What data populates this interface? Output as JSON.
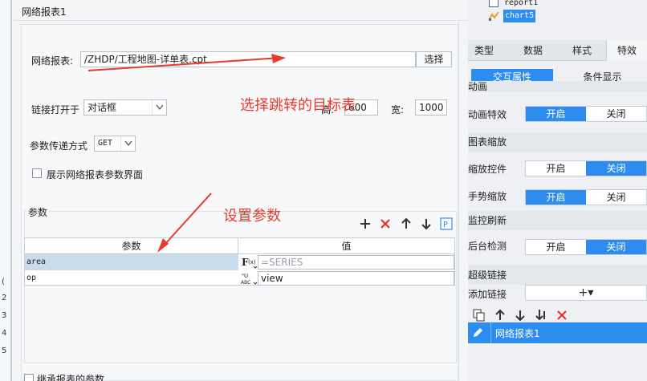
{
  "dialog": {
    "title": "网络报表1",
    "report_label": "网络报表:",
    "report_path": "/ZHDP/工程地图-详单表.cpt",
    "choose_button": "选择",
    "open_in_label": "链接打开于",
    "open_in_value": "对话框",
    "height_label": "高:",
    "height_value": "600",
    "width_label": "宽:",
    "width_value": "1000",
    "method_label": "参数传递方式",
    "method_value": "GET",
    "show_param_ui_label": "展示网络报表参数界面",
    "params_section_label": "参数",
    "params_table": {
      "headers": [
        "参数",
        "值"
      ],
      "rows": [
        {
          "name": "area",
          "type": "F(x)",
          "value": "=SERIES"
        },
        {
          "name": "op",
          "type": "ABC",
          "value": "view"
        }
      ]
    },
    "inherit_label": "继承报表的参数"
  },
  "annotations": {
    "target_note": "选择跳转的目标表",
    "params_note": "设置参数"
  },
  "right_panel": {
    "tree": [
      "report1",
      "chart5"
    ],
    "tabs": [
      "类型",
      "数据",
      "样式",
      "特效"
    ],
    "subtabs": [
      "交互属性",
      "条件显示"
    ],
    "sections": {
      "animation": {
        "title": "动画",
        "item_label": "动画特效",
        "on": "开启",
        "off": "关闭"
      },
      "zoom": {
        "title": "图表缩放",
        "control_label": "缩放控件",
        "gesture_label": "手势缩放",
        "on": "开启",
        "off": "关闭"
      },
      "monitor": {
        "title": "监控刷新",
        "detect_label": "后台检测",
        "on": "开启",
        "off": "关闭"
      },
      "hyperlink": {
        "title": "超级链接",
        "add_label": "添加链接",
        "add_icon": "+▾",
        "item": "网络报表1"
      }
    }
  },
  "background": {
    "row_numbers": [
      "(",
      "2",
      "3",
      "4",
      "5"
    ]
  },
  "colors": {
    "accent": "#2d8cf0",
    "annotation": "#e83a2d"
  }
}
